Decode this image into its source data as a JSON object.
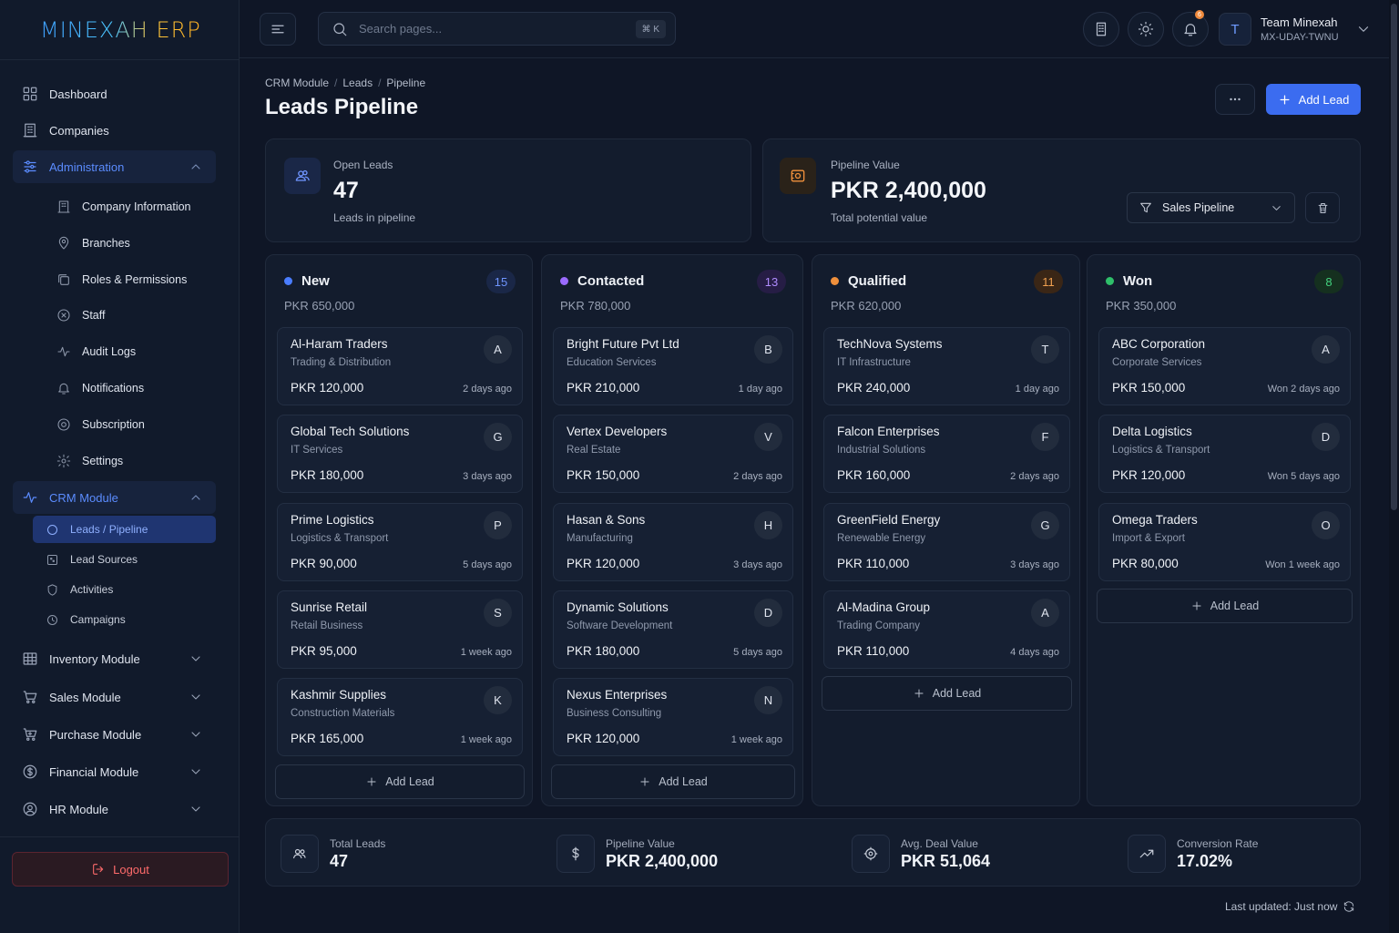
{
  "app": {
    "logo_text": "MINEXAH ERP"
  },
  "sidebar": {
    "main_items": [
      {
        "label": "Dashboard"
      },
      {
        "label": "Companies"
      }
    ],
    "administration": {
      "label": "Administration",
      "items": [
        {
          "label": "Company Information"
        },
        {
          "label": "Branches"
        },
        {
          "label": "Roles & Permissions"
        },
        {
          "label": "Staff"
        },
        {
          "label": "Audit Logs"
        },
        {
          "label": "Notifications"
        },
        {
          "label": "Subscription"
        },
        {
          "label": "Settings"
        }
      ]
    },
    "crm": {
      "label": "CRM Module",
      "items": [
        {
          "label": "Leads / Pipeline"
        },
        {
          "label": "Lead Sources"
        },
        {
          "label": "Activities"
        },
        {
          "label": "Campaigns"
        }
      ]
    },
    "modules": [
      {
        "label": "Inventory Module"
      },
      {
        "label": "Sales Module"
      },
      {
        "label": "Purchase Module"
      },
      {
        "label": "Financial Module"
      },
      {
        "label": "HR Module"
      }
    ],
    "logout_label": "Logout"
  },
  "topbar": {
    "search_placeholder": "Search pages...",
    "shortcut": "⌘ K",
    "notification_count": "6",
    "user_initial": "T",
    "user_name": "Team Minexah",
    "user_id": "MX-UDAY-TWNU"
  },
  "page": {
    "breadcrumb": [
      "CRM Module",
      "Leads",
      "Pipeline"
    ],
    "title": "Leads Pipeline",
    "add_lead_label": "Add Lead"
  },
  "stats": {
    "open_leads": {
      "label": "Open Leads",
      "value": "47",
      "sub": "Leads in pipeline"
    },
    "pipeline_value": {
      "label": "Pipeline Value",
      "value": "PKR 2,400,000",
      "sub": "Total potential value"
    },
    "pipeline_select": "Sales Pipeline"
  },
  "columns": [
    {
      "title": "New",
      "count": "15",
      "total": "PKR 650,000",
      "color": "#4a7dff",
      "leads": [
        {
          "name": "Al-Haram Traders",
          "category": "Trading & Distribution",
          "value": "PKR 120,000",
          "time": "2 days ago",
          "initial": "A"
        },
        {
          "name": "Global Tech Solutions",
          "category": "IT Services",
          "value": "PKR 180,000",
          "time": "3 days ago",
          "initial": "G"
        },
        {
          "name": "Prime Logistics",
          "category": "Logistics & Transport",
          "value": "PKR 90,000",
          "time": "5 days ago",
          "initial": "P"
        },
        {
          "name": "Sunrise Retail",
          "category": "Retail Business",
          "value": "PKR 95,000",
          "time": "1 week ago",
          "initial": "S"
        },
        {
          "name": "Kashmir Supplies",
          "category": "Construction Materials",
          "value": "PKR 165,000",
          "time": "1 week ago",
          "initial": "K"
        }
      ],
      "add_label": "Add Lead"
    },
    {
      "title": "Contacted",
      "count": "13",
      "total": "PKR 780,000",
      "color": "#9b6bff",
      "leads": [
        {
          "name": "Bright Future Pvt Ltd",
          "category": "Education Services",
          "value": "PKR 210,000",
          "time": "1 day ago",
          "initial": "B"
        },
        {
          "name": "Vertex Developers",
          "category": "Real Estate",
          "value": "PKR 150,000",
          "time": "2 days ago",
          "initial": "V"
        },
        {
          "name": "Hasan & Sons",
          "category": "Manufacturing",
          "value": "PKR 120,000",
          "time": "3 days ago",
          "initial": "H"
        },
        {
          "name": "Dynamic Solutions",
          "category": "Software Development",
          "value": "PKR 180,000",
          "time": "5 days ago",
          "initial": "D"
        },
        {
          "name": "Nexus Enterprises",
          "category": "Business Consulting",
          "value": "PKR 120,000",
          "time": "1 week ago",
          "initial": "N"
        }
      ],
      "add_label": "Add Lead"
    },
    {
      "title": "Qualified",
      "count": "11",
      "total": "PKR 620,000",
      "color": "#f0903c",
      "leads": [
        {
          "name": "TechNova Systems",
          "category": "IT Infrastructure",
          "value": "PKR 240,000",
          "time": "1 day ago",
          "initial": "T"
        },
        {
          "name": "Falcon Enterprises",
          "category": "Industrial Solutions",
          "value": "PKR 160,000",
          "time": "2 days ago",
          "initial": "F"
        },
        {
          "name": "GreenField Energy",
          "category": "Renewable Energy",
          "value": "PKR 110,000",
          "time": "3 days ago",
          "initial": "G"
        },
        {
          "name": "Al-Madina Group",
          "category": "Trading Company",
          "value": "PKR 110,000",
          "time": "4 days ago",
          "initial": "A"
        }
      ],
      "add_label": "Add Lead"
    },
    {
      "title": "Won",
      "count": "8",
      "total": "PKR 350,000",
      "color": "#2fbf6a",
      "leads": [
        {
          "name": "ABC Corporation",
          "category": "Corporate Services",
          "value": "PKR 150,000",
          "time": "Won 2 days ago",
          "initial": "A"
        },
        {
          "name": "Delta Logistics",
          "category": "Logistics & Transport",
          "value": "PKR 120,000",
          "time": "Won 5 days ago",
          "initial": "D"
        },
        {
          "name": "Omega Traders",
          "category": "Import & Export",
          "value": "PKR 80,000",
          "time": "Won 1 week ago",
          "initial": "O"
        }
      ],
      "add_label": "Add Lead"
    }
  ],
  "summary": [
    {
      "label": "Total Leads",
      "value": "47",
      "icon": "users-icon"
    },
    {
      "label": "Pipeline Value",
      "value": "PKR 2,400,000",
      "icon": "dollar-icon"
    },
    {
      "label": "Avg. Deal Value",
      "value": "PKR 51,064",
      "icon": "deal-icon"
    },
    {
      "label": "Conversion Rate",
      "value": "17.02%",
      "icon": "trend-icon"
    }
  ],
  "last_updated": "Last updated: Just now"
}
